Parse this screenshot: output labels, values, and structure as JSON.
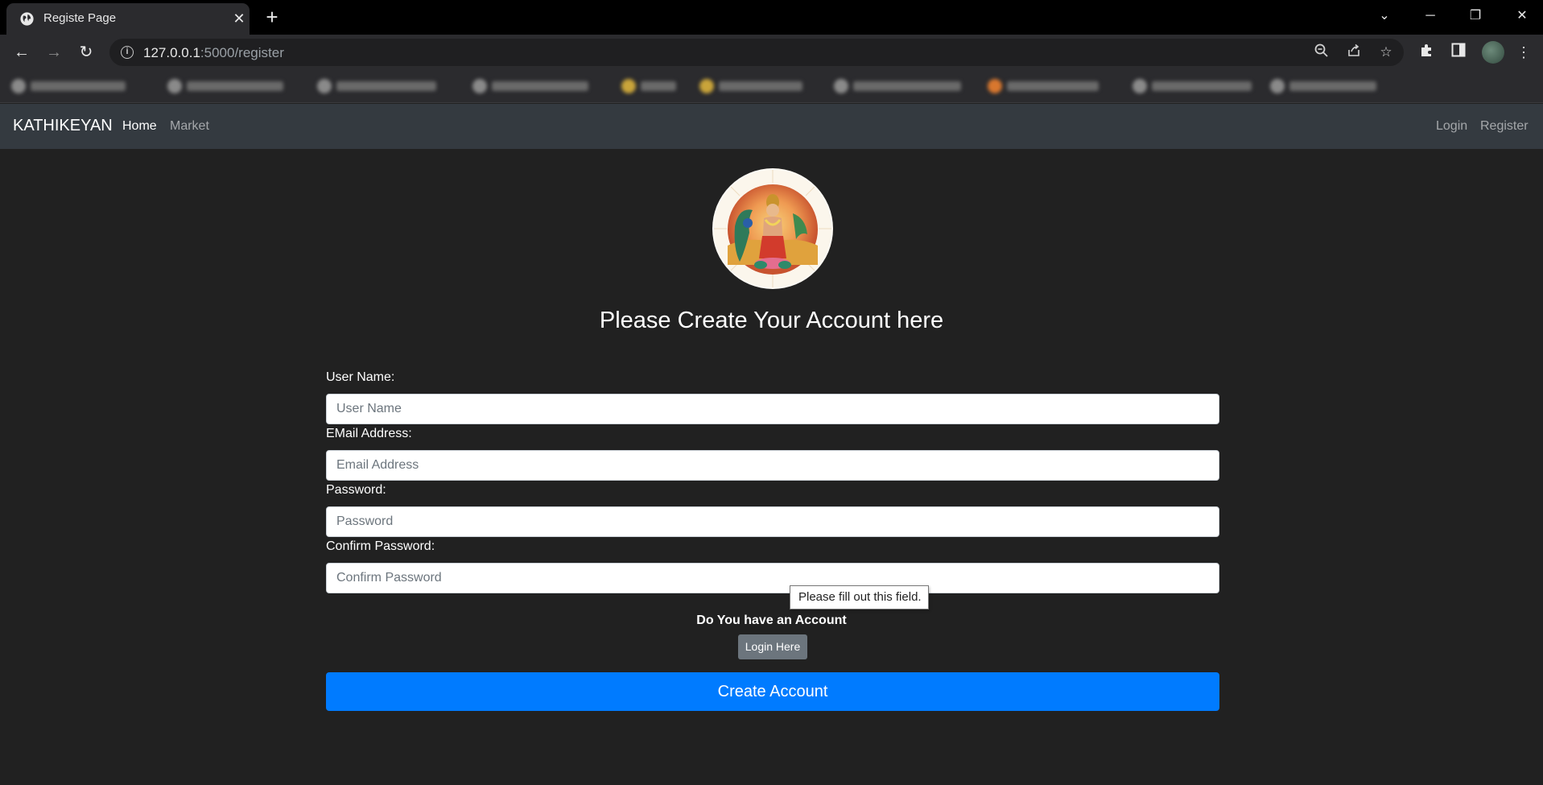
{
  "browser": {
    "tab_title": "Registe Page",
    "url_host": "127.0.0.1",
    "url_path": ":5000/register",
    "icons": [
      "globe-icon",
      "close-icon",
      "plus-icon",
      "chevron-down-icon",
      "minimize-icon",
      "restore-icon",
      "back-icon",
      "forward-icon",
      "reload-icon",
      "info-icon",
      "zoom-icon",
      "share-icon",
      "star-icon",
      "extensions-icon",
      "sidepanel-icon",
      "menu-icon"
    ]
  },
  "navbar": {
    "brand": "KATHIKEYAN",
    "links": [
      "Home",
      "Market"
    ],
    "right_links": [
      "Login",
      "Register"
    ]
  },
  "form": {
    "heading": "Please Create Your Account here",
    "fields": [
      {
        "label": "User Name:",
        "placeholder": "User Name"
      },
      {
        "label": "EMail Address:",
        "placeholder": "Email Address"
      },
      {
        "label": "Password:",
        "placeholder": "Password"
      },
      {
        "label": "Confirm Password:",
        "placeholder": "Confirm Password"
      }
    ],
    "validation_tooltip": "Please fill out this field.",
    "account_question": "Do You have an Account",
    "login_button": "Login Here",
    "submit_button": "Create Account"
  },
  "colors": {
    "page_bg": "#212121",
    "navbar_bg": "#343a40",
    "primary": "#007bff",
    "secondary": "#6c757d"
  }
}
